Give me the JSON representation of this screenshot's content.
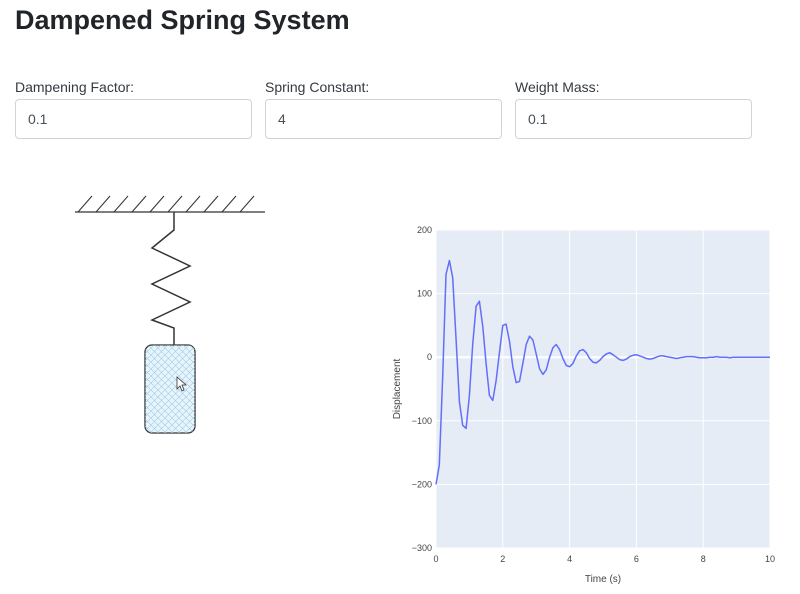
{
  "page": {
    "title": "Dampened Spring System"
  },
  "controls": [
    {
      "label": "Dampening Factor:",
      "value": "0.1"
    },
    {
      "label": "Spring Constant:",
      "value": "4"
    },
    {
      "label": "Weight Mass:",
      "value": "0.1"
    }
  ],
  "colors": {
    "plot_bg": "#e5ecf6",
    "line": "#636efa",
    "weight_fill": "#e8f4fb",
    "weight_hatch": "#9dcbe6"
  },
  "chart_data": {
    "type": "line",
    "title": "",
    "xlabel": "Time (s)",
    "ylabel": "Displacement",
    "xlim": [
      0,
      10
    ],
    "ylim": [
      -300,
      200
    ],
    "x_ticks": [
      "0",
      "2",
      "4",
      "6",
      "8",
      "10"
    ],
    "y_ticks": [
      "200",
      "100",
      "0",
      "−100",
      "−200",
      "−300"
    ],
    "grid": true,
    "x": [
      0,
      0.1,
      0.2,
      0.3,
      0.4,
      0.5,
      0.6,
      0.7,
      0.8,
      0.9,
      1.0,
      1.1,
      1.2,
      1.3,
      1.4,
      1.5,
      1.6,
      1.7,
      1.8,
      1.9,
      2.0,
      2.1,
      2.2,
      2.3,
      2.4,
      2.5,
      2.6,
      2.7,
      2.8,
      2.9,
      3.0,
      3.1,
      3.2,
      3.3,
      3.4,
      3.5,
      3.6,
      3.7,
      3.8,
      3.9,
      4.0,
      4.1,
      4.2,
      4.3,
      4.4,
      4.5,
      4.6,
      4.7,
      4.8,
      4.9,
      5.0,
      5.1,
      5.2,
      5.3,
      5.4,
      5.5,
      5.6,
      5.7,
      5.8,
      5.9,
      6.0,
      6.1,
      6.2,
      6.3,
      6.4,
      6.5,
      6.6,
      6.7,
      6.8,
      6.9,
      7.0,
      7.1,
      7.2,
      7.3,
      7.4,
      7.5,
      7.6,
      7.7,
      7.8,
      7.9,
      8.0,
      8.1,
      8.2,
      8.3,
      8.4,
      8.5,
      8.6,
      8.7,
      8.8,
      8.9,
      9.0,
      9.1,
      9.2,
      9.3,
      9.4,
      9.5,
      9.6,
      9.7,
      9.8,
      9.9,
      10.0
    ],
    "series": [
      {
        "values": [
          -200,
          -170,
          -30,
          130,
          152,
          125,
          30,
          -70,
          -107,
          -112,
          -60,
          20,
          80,
          88,
          48,
          -10,
          -60,
          -68,
          -37,
          8,
          50,
          52,
          25,
          -15,
          -40,
          -38,
          -10,
          20,
          33,
          27,
          5,
          -18,
          -27,
          -20,
          0,
          15,
          20,
          12,
          -2,
          -13,
          -15,
          -10,
          2,
          10,
          12,
          7,
          -2,
          -8,
          -9,
          -5,
          1,
          5,
          7,
          4,
          0,
          -4,
          -5,
          -3,
          1,
          3,
          4,
          2,
          0,
          -2,
          -3,
          -2,
          0,
          2,
          2,
          1,
          0,
          -1,
          -2,
          -1,
          0,
          1,
          1,
          1,
          0,
          -1,
          -1,
          -1,
          0,
          0,
          1,
          0,
          0,
          0,
          -1,
          0,
          0,
          0,
          0,
          0,
          0,
          0,
          0,
          0,
          0,
          0,
          0
        ]
      }
    ]
  }
}
